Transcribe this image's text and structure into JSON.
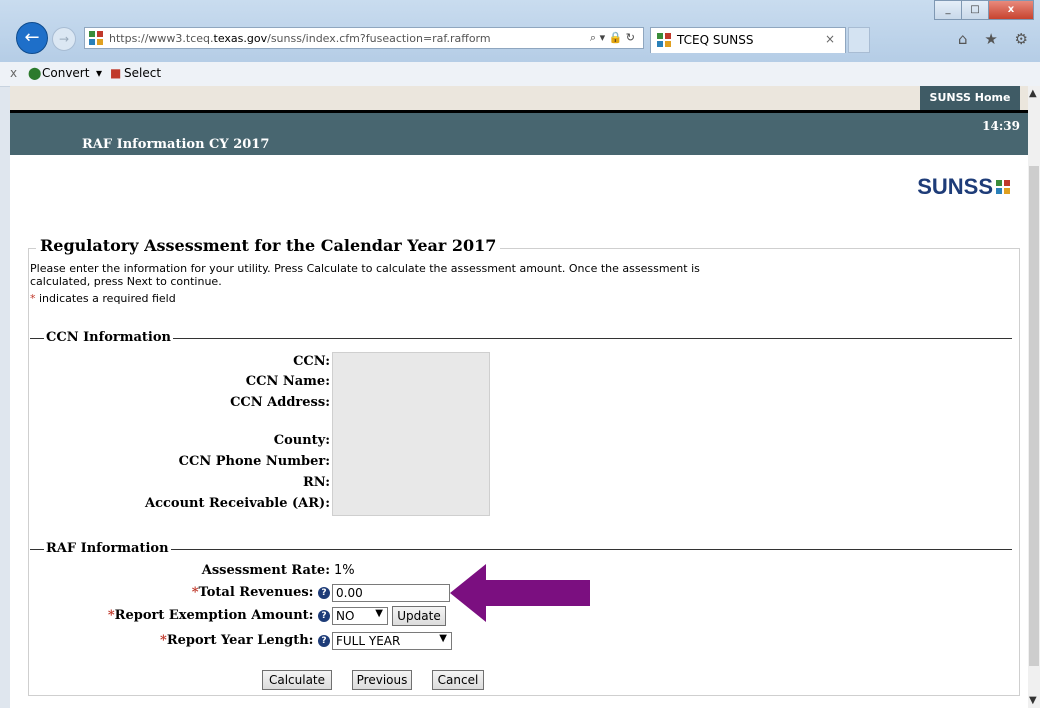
{
  "browser": {
    "url_prefix": "https://www3.tceq.",
    "url_domain": "texas.gov",
    "url_suffix": "/sunss/index.cfm?fuseaction=raf.rafform",
    "address_icons": "⌕ ▾ 🔒 ↻",
    "tab_title": "TCEQ SUNSS",
    "tab_close": "×",
    "minimize": "_",
    "maximize": "□",
    "close": "x",
    "toolbar_icons": "⌂ ★ ⚙"
  },
  "commandbar": {
    "close_label": "x",
    "convert_label": "Convert",
    "convert_arrow": "▾",
    "select_label": "Select"
  },
  "header": {
    "home_link": "SUNSS Home",
    "time": "14:39",
    "title": "RAF Information CY 2017",
    "logo_text": "SUNSS"
  },
  "form": {
    "legend": "Regulatory Assessment for the Calendar Year 2017",
    "intro": "Please enter the information for your utility. Press Calculate to calculate the assessment amount. Once the assessment is calculated, press Next to continue.",
    "required_star": "*",
    "required_note": " indicates a required field",
    "ccn_section": "CCN Information",
    "ccn_fields": {
      "ccn": "CCN:",
      "name": "CCN Name:",
      "address": "CCN Address:",
      "county": "County:",
      "phone": "CCN Phone Number:",
      "rn": "RN:",
      "ar": "Account Receivable (AR):"
    },
    "raf_section": "RAF Information",
    "assessment_rate_label": "Assessment Rate:",
    "assessment_rate_value": "1%",
    "total_revenues_label": "Total Revenues:",
    "total_revenues_value": "0.00",
    "exemption_label": "Report Exemption Amount:",
    "exemption_value": "NO",
    "update_button": "Update",
    "year_length_label": "Report Year Length:",
    "year_length_value": "FULL YEAR",
    "help_glyph": "?",
    "calculate_button": "Calculate",
    "previous_button": "Previous",
    "cancel_button": "Cancel"
  },
  "colors": {
    "header_bar": "#486670",
    "annotation_arrow": "#7b0f80",
    "logo": "#1e3c78"
  }
}
